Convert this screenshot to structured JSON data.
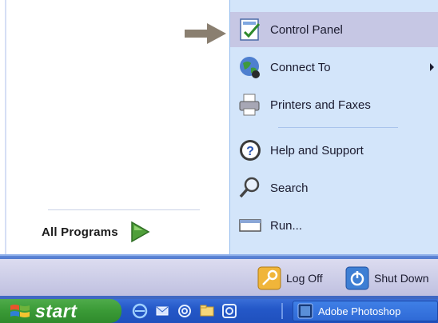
{
  "menu": {
    "all_programs": "All Programs",
    "items": [
      {
        "label": "Control Panel",
        "icon": "control-panel-icon",
        "highlighted": true
      },
      {
        "label": "Connect To",
        "icon": "globe-icon",
        "has_submenu": true
      },
      {
        "label": "Printers and Faxes",
        "icon": "printer-icon"
      },
      {
        "label": "Help and Support",
        "icon": "help-icon"
      },
      {
        "label": "Search",
        "icon": "search-icon"
      },
      {
        "label": "Run...",
        "icon": "run-icon"
      }
    ]
  },
  "footer": {
    "log_off": "Log Off",
    "shut_down": "Shut Down"
  },
  "taskbar": {
    "start_label": "start",
    "quick_launch": [
      "ie-icon",
      "outlook-icon",
      "at-icon",
      "folder-icon",
      "media-icon"
    ],
    "task": "Adobe Photoshop"
  },
  "colors": {
    "highlight": "#c6c7e4",
    "right_pane": "#d3e5fa",
    "start_green": "#3a9a36",
    "taskbar_blue": "#2458c8"
  }
}
